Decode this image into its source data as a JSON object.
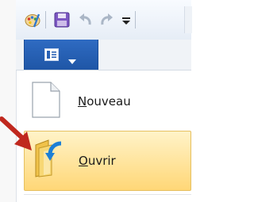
{
  "quick_access_toolbar": {
    "icons": [
      "paint-icon",
      "save-icon",
      "undo-icon",
      "redo-icon",
      "customize-toolbar-icon"
    ]
  },
  "app_menu_button": {
    "icons": [
      "document-icon",
      "chevron-down-icon"
    ],
    "accent": "#2a62b5"
  },
  "menu": {
    "items": [
      {
        "mnemonic": "N",
        "rest": "ouveau",
        "icon": "blank-page-icon",
        "highlighted": false
      },
      {
        "mnemonic": "O",
        "rest": "uvrir",
        "icon": "open-folder-icon",
        "highlighted": true
      }
    ]
  },
  "annotation": {
    "icon": "red-arrow-icon",
    "color": "#c0281e"
  },
  "colors": {
    "highlight": "#ffd777",
    "highlight_border": "#e6c060"
  }
}
